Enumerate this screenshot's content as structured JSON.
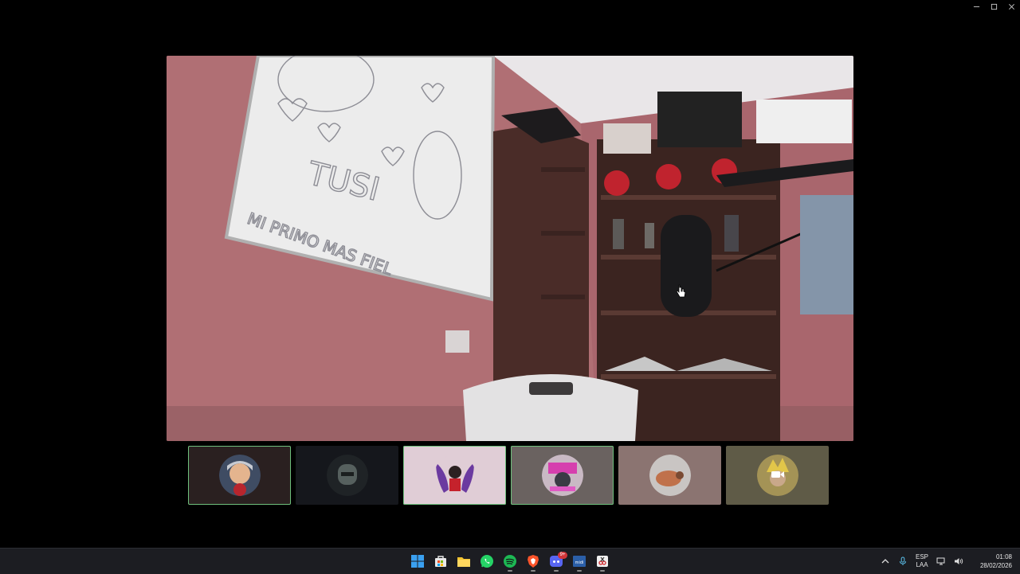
{
  "window": {
    "controls": [
      "minimize-icon",
      "maximize-icon",
      "close-icon"
    ]
  },
  "main_video": {
    "content": "live camera feed",
    "whiteboard_text": [
      "TUSI",
      "MI PRIMO MAS FIEL"
    ]
  },
  "participants": [
    {
      "avatar": "anime-character-avatar",
      "active": true,
      "bg": "#2a2020"
    },
    {
      "avatar": "helmet-character-avatar",
      "active": false,
      "bg": "#15171c"
    },
    {
      "avatar": "winged-character-avatar",
      "active": true,
      "bg": "#e0cdd6"
    },
    {
      "avatar": "collage-avatar",
      "active": true,
      "bg": "#6a6260"
    },
    {
      "avatar": "animal-photo-avatar",
      "active": false,
      "bg": "#8b7471"
    },
    {
      "avatar": "golden-character-avatar",
      "active": false,
      "bg": "#5f5b47",
      "camera_icon": "video-camera-icon"
    }
  ],
  "taskbar": {
    "apps": [
      {
        "name": "start",
        "icon": "windows-start-icon"
      },
      {
        "name": "store",
        "icon": "store-icon"
      },
      {
        "name": "file-explorer",
        "icon": "folder-icon"
      },
      {
        "name": "whatsapp",
        "icon": "whatsapp-icon"
      },
      {
        "name": "spotify",
        "icon": "spotify-icon"
      },
      {
        "name": "brave",
        "icon": "brave-icon"
      },
      {
        "name": "discord",
        "icon": "discord-icon",
        "badge": "9+"
      },
      {
        "name": "media",
        "icon": "media-app-icon",
        "label": "midi"
      },
      {
        "name": "snipping",
        "icon": "snipping-tool-icon"
      }
    ],
    "tray": {
      "lang_top": "ESP",
      "lang_bottom": "LAA",
      "time": "01:08",
      "date": "28/02/2026"
    }
  }
}
